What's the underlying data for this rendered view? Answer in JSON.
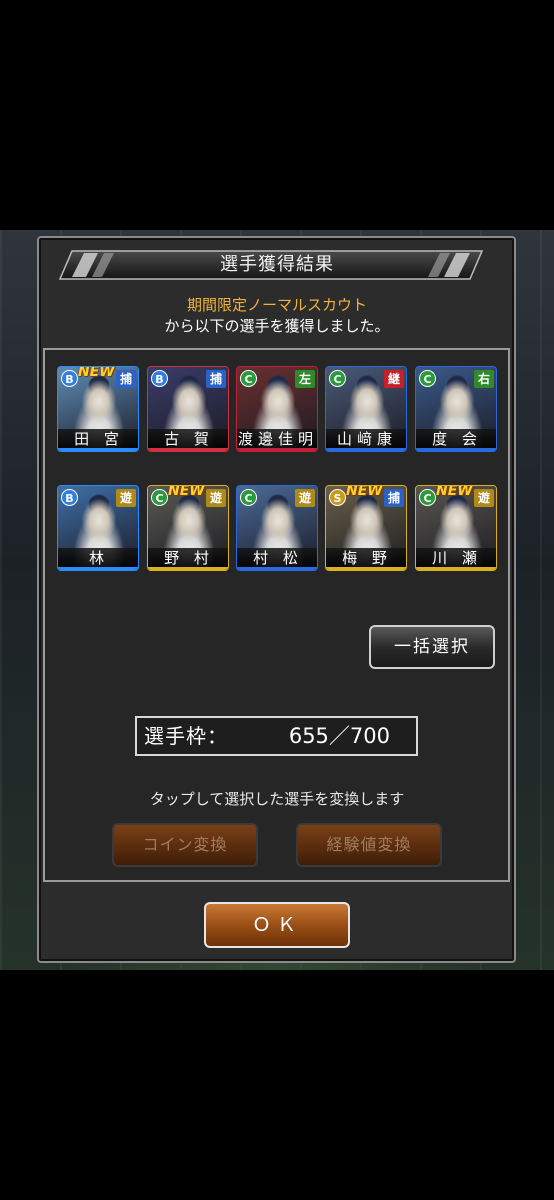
{
  "dialog": {
    "title": "選手獲得結果",
    "scout_name": "期間限定ノーマルスカウト",
    "message": "から以下の選手を獲得しました。"
  },
  "players": [
    {
      "name": "田 宮",
      "rank": "B",
      "position": "捕",
      "is_new": true,
      "new_label": "NEW",
      "rank_color": "#2f7ee0",
      "pos_color": "#2a62c8",
      "stripe": "#2a8bff",
      "bg": "#5f8db8"
    },
    {
      "name": "古 賀",
      "rank": "B",
      "position": "捕",
      "is_new": false,
      "new_label": "",
      "rank_color": "#2f7ee0",
      "pos_color": "#2a62c8",
      "stripe": "#d03040",
      "bg": "#3b3c6a"
    },
    {
      "name": "渡邊佳明",
      "rank": "C",
      "position": "左",
      "is_new": false,
      "new_label": "",
      "rank_color": "#2a9a3a",
      "pos_color": "#2f8a2a",
      "stripe": "#c0203a",
      "bg": "#6a3030"
    },
    {
      "name": "山﨑康",
      "rank": "C",
      "position": "継",
      "is_new": false,
      "new_label": "",
      "rank_color": "#2a9a3a",
      "pos_color": "#c8202a",
      "stripe": "#2a6ae0",
      "bg": "#4a5a78"
    },
    {
      "name": "度 会",
      "rank": "C",
      "position": "右",
      "is_new": false,
      "new_label": "",
      "rank_color": "#2a9a3a",
      "pos_color": "#2f8a2a",
      "stripe": "#2a6ae0",
      "bg": "#3a5a8a"
    },
    {
      "name": "林",
      "rank": "B",
      "position": "遊",
      "is_new": false,
      "new_label": "",
      "rank_color": "#2f7ee0",
      "pos_color": "#b08a18",
      "stripe": "#2a8bff",
      "bg": "#3f6fa8"
    },
    {
      "name": "野 村",
      "rank": "C",
      "position": "遊",
      "is_new": true,
      "new_label": "NEW",
      "rank_color": "#2a9a3a",
      "pos_color": "#b08a18",
      "stripe": "#d8b020",
      "bg": "#5a5a52"
    },
    {
      "name": "村 松",
      "rank": "C",
      "position": "遊",
      "is_new": false,
      "new_label": "",
      "rank_color": "#2a9a3a",
      "pos_color": "#b08a18",
      "stripe": "#2a6ae0",
      "bg": "#4a6a98"
    },
    {
      "name": "梅 野",
      "rank": "S",
      "position": "捕",
      "is_new": true,
      "new_label": "NEW",
      "rank_color": "#c89a1a",
      "pos_color": "#2a62c8",
      "stripe": "#d8b020",
      "bg": "#6a6048"
    },
    {
      "name": "川 瀬",
      "rank": "C",
      "position": "遊",
      "is_new": true,
      "new_label": "NEW",
      "rank_color": "#2a9a3a",
      "pos_color": "#b08a18",
      "stripe": "#d8b020",
      "bg": "#5a5650"
    }
  ],
  "buttons": {
    "bulk_select": "一括選択",
    "coin_convert": "コイン変換",
    "exp_convert": "経験値変換",
    "ok": "ＯＫ"
  },
  "roster": {
    "label": "選手枠：",
    "value": "655／700"
  },
  "hint": "タップして選択した選手を変換します"
}
